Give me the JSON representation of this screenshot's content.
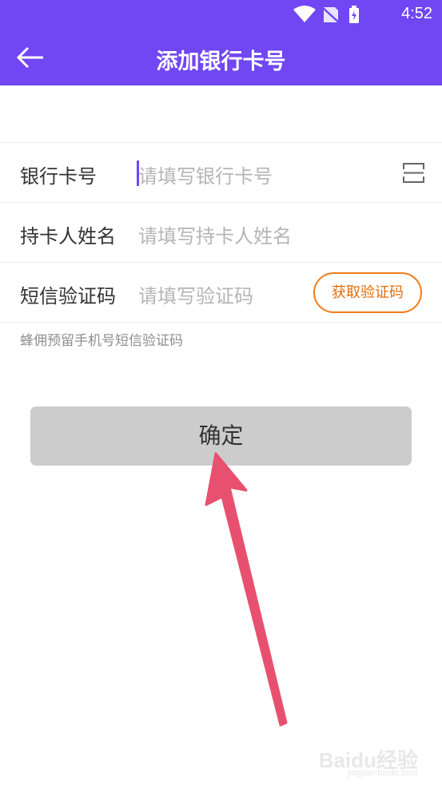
{
  "status_bar": {
    "time": "4:52"
  },
  "app_bar": {
    "title": "添加银行卡号"
  },
  "form": {
    "rows": [
      {
        "label": "银行卡号",
        "placeholder": "请填写银行卡号"
      },
      {
        "label": "持卡人姓名",
        "placeholder": "请填写持卡人姓名"
      },
      {
        "label": "短信验证码",
        "placeholder": "请填写验证码",
        "button_label": "获取验证码"
      }
    ],
    "hint": "蜂佣预留手机号短信验证码"
  },
  "confirm_button": {
    "label": "确定"
  },
  "watermark": {
    "text": "Baidu经验",
    "sub": "jingyan.baidu.com"
  },
  "colors": {
    "primary": "#7047f2",
    "accent": "#f07c1a",
    "annotation_arrow": "#e8506f"
  }
}
